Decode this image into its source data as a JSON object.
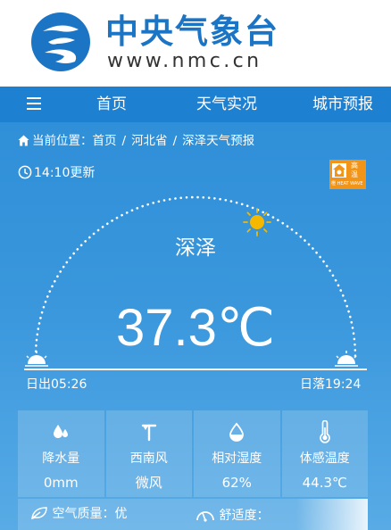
{
  "brand": {
    "title": "中央气象台",
    "url": "www.nmc.cn"
  },
  "nav": {
    "items": [
      "首页",
      "天气实况",
      "城市预报"
    ]
  },
  "breadcrumb": {
    "prefix": "当前位置：",
    "items": [
      "首页",
      "河北省",
      "深泽天气预报"
    ]
  },
  "update_time": "14:10更新",
  "alert": {
    "type": "高温",
    "color": "橙",
    "sub": "橙 HEAT WAVE"
  },
  "city": "深泽",
  "temperature": "37.3℃",
  "sun": {
    "sunrise": "日出05:26",
    "sunset": "日落19:24"
  },
  "stats": [
    {
      "icon": "raindrop-icon",
      "label": "降水量",
      "value": "0mm"
    },
    {
      "icon": "wind-icon",
      "label": "西南风",
      "value": "微风"
    },
    {
      "icon": "humidity-icon",
      "label": "相对湿度",
      "value": "62%"
    },
    {
      "icon": "thermometer-icon",
      "label": "体感温度",
      "value": "44.3℃"
    }
  ],
  "bottom": {
    "aqi": "空气质量：优",
    "comfort": "舒适度："
  },
  "colors": {
    "header_blue": "#1b74c4",
    "nav_bar": "#1e80d0",
    "background": "#2f8fd8",
    "alert_orange": "#f29418",
    "sun_yellow": "#f5b800"
  }
}
